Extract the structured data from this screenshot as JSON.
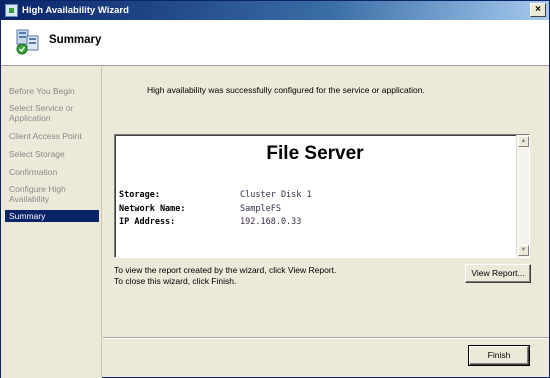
{
  "window": {
    "title": "High Availability Wizard",
    "close_glyph": "×"
  },
  "header": {
    "title": "Summary",
    "icon": "cluster-wizard-icon"
  },
  "sidebar": {
    "items": [
      {
        "label": "Before You Begin"
      },
      {
        "label": "Select Service or Application"
      },
      {
        "label": "Client Access Point"
      },
      {
        "label": "Select Storage"
      },
      {
        "label": "Confirmation"
      },
      {
        "label": "Configure High Availability"
      },
      {
        "label": "Summary"
      }
    ]
  },
  "main": {
    "status": "High availability was successfully configured for the service or application.",
    "report": {
      "heading": "File Server",
      "rows": [
        {
          "key": "Storage:",
          "value": "Cluster Disk 1"
        },
        {
          "key": "Network Name:",
          "value": "SampleFS"
        },
        {
          "key": "IP Address:",
          "value": "192.168.0.33"
        }
      ]
    },
    "info_line1": "To view the report created by the wizard, click View Report.",
    "info_line2": "To close this wizard, click Finish.",
    "view_report_label": "View Report...",
    "finish_label": "Finish"
  },
  "colors": {
    "active_nav": "#0a246a",
    "titlebar": "#0a246a",
    "window_bg": "#ece9d8"
  }
}
